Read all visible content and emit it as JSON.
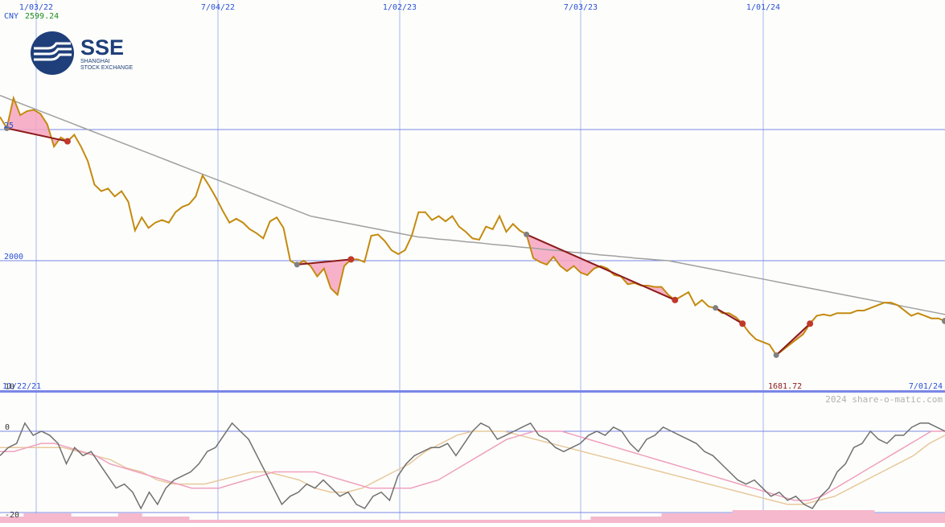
{
  "header": {
    "currency": "CNY",
    "last_value": "2599.24"
  },
  "logo": {
    "name": "SSE",
    "line1": "SHANGHAI",
    "line2": "STOCK EXCHANGE"
  },
  "colors": {
    "price": "#c48a0f",
    "moving_average": "#a0a0a0",
    "grid": "#a8b4f2",
    "grid_strong": "#7a86e6",
    "up_fill": "#7ee67e",
    "down_fill": "#f6a4c0",
    "up_trend": "#2a9a2a",
    "down_trend": "#8b1a1a",
    "osc_main": "#707070",
    "osc_fast": "#f0a0c0",
    "osc_slow": "#e8c89c",
    "volume": "#f6b8cc",
    "header_currency": "#2a4fd8",
    "header_value": "#1f8a1f"
  },
  "chart_data": [
    {
      "type": "line",
      "title": "",
      "x_labels_top": [
        "1/03/22",
        "7/04/22",
        "1/02/23",
        "7/03/23",
        "1/01/24"
      ],
      "x_range_labels": {
        "start": "11/22/21",
        "end": "7/01/24"
      },
      "y_tick_labels": [
        "25",
        "2000"
      ],
      "y_ticks": [
        2500,
        2000
      ],
      "ylim": [
        1530,
        2620
      ],
      "min_label": "1681.72",
      "watermark": "2024 share-o-matic.com",
      "grid": true,
      "series": [
        {
          "role": "price",
          "values": [
            2548,
            2505,
            2620,
            2555,
            2570,
            2575,
            2560,
            2520,
            2435,
            2470,
            2455,
            2480,
            2435,
            2380,
            2290,
            2265,
            2275,
            2245,
            2265,
            2225,
            2115,
            2165,
            2125,
            2145,
            2155,
            2145,
            2185,
            2205,
            2215,
            2245,
            2325,
            2285,
            2240,
            2190,
            2145,
            2160,
            2145,
            2120,
            2105,
            2085,
            2150,
            2165,
            2125,
            2000,
            1985,
            2000,
            1980,
            1940,
            1970,
            1895,
            1870,
            1980,
            2005,
            2005,
            1995,
            2095,
            2100,
            2075,
            2040,
            2025,
            2040,
            2095,
            2185,
            2185,
            2155,
            2170,
            2150,
            2170,
            2130,
            2110,
            2085,
            2080,
            2130,
            2120,
            2170,
            2110,
            2140,
            2115,
            2100,
            2010,
            1995,
            1985,
            2015,
            1980,
            1960,
            1980,
            1955,
            1945,
            1970,
            1980,
            1970,
            1945,
            1940,
            1910,
            1915,
            1905,
            1905,
            1900,
            1900,
            1870,
            1850,
            1865,
            1880,
            1830,
            1850,
            1825,
            1820,
            1800,
            1800,
            1785,
            1760,
            1725,
            1700,
            1690,
            1680,
            1640,
            1660,
            1680,
            1700,
            1720,
            1760,
            1790,
            1795,
            1790,
            1800,
            1800,
            1800,
            1810,
            1810,
            1820,
            1830,
            1840,
            1840,
            1830,
            1810,
            1790,
            1800,
            1790,
            1780,
            1780,
            1770
          ]
        },
        {
          "role": "moving_average",
          "values": [
            2630,
            2620,
            2610,
            2600,
            2590,
            2580,
            2570,
            2560,
            2550,
            2540,
            2530,
            2520,
            2510,
            2500,
            2490,
            2480,
            2470,
            2460,
            2450,
            2440,
            2430,
            2420,
            2410,
            2400,
            2390,
            2380,
            2370,
            2360,
            2350,
            2340,
            2330,
            2320,
            2310,
            2300,
            2290,
            2280,
            2270,
            2260,
            2250,
            2240,
            2230,
            2220,
            2210,
            2200,
            2190,
            2180,
            2170,
            2165,
            2160,
            2155,
            2150,
            2145,
            2140,
            2135,
            2130,
            2125,
            2120,
            2115,
            2110,
            2105,
            2100,
            2095,
            2090,
            2088,
            2085,
            2082,
            2080,
            2078,
            2075,
            2072,
            2070,
            2068,
            2065,
            2062,
            2060,
            2058,
            2055,
            2052,
            2050,
            2048,
            2045,
            2042,
            2040,
            2038,
            2035,
            2032,
            2030,
            2028,
            2025,
            2022,
            2020,
            2018,
            2015,
            2013,
            2010,
            2008,
            2006,
            2004,
            2002,
            2000,
            1995,
            1990,
            1985,
            1980,
            1975,
            1970,
            1965,
            1960,
            1955,
            1950,
            1945,
            1940,
            1935,
            1930,
            1925,
            1920,
            1915,
            1910,
            1905,
            1900,
            1895,
            1890,
            1885,
            1880,
            1875,
            1870,
            1865,
            1860,
            1855,
            1850,
            1845,
            1840,
            1835,
            1830,
            1825,
            1820,
            1815,
            1810,
            1805,
            1800,
            1795
          ]
        }
      ],
      "trend_lines": [
        {
          "direction": "down",
          "from": [
            1,
            2500
          ],
          "to": [
            10,
            2450
          ]
        },
        {
          "direction": "down",
          "from": [
            44,
            2260
          ],
          "to": [
            52,
            2140
          ]
        },
        {
          "direction": "down",
          "from": [
            78,
            2110
          ],
          "to": [
            100,
            2080
          ]
        },
        {
          "direction": "down",
          "from": [
            106,
            2100
          ],
          "to": [
            110,
            2060
          ]
        },
        {
          "direction": "down",
          "from": [
            115,
            2115
          ],
          "to": [
            120,
            2095
          ]
        },
        {
          "direction": "up",
          "from": [
            172,
            1830
          ],
          "to": [
            198,
            1860
          ]
        }
      ]
    },
    {
      "type": "line",
      "y_tick_labels": [
        "10",
        "0",
        "-20"
      ],
      "y_ticks": [
        10,
        0,
        -20
      ],
      "ylim": [
        -20,
        10
      ],
      "grid": true,
      "series": [
        {
          "role": "oscillator",
          "values": [
            -6,
            -4,
            -3,
            2,
            -1,
            0,
            -1,
            -3,
            -8,
            -4,
            -6,
            -5,
            -8,
            -11,
            -14,
            -13,
            -15,
            -19,
            -15,
            -18,
            -14,
            -12,
            -11,
            -10,
            -8,
            -5,
            -4,
            -1,
            2,
            0,
            -2,
            -6,
            -10,
            -14,
            -18,
            -16,
            -15,
            -13,
            -14,
            -12,
            -14,
            -16,
            -15,
            -18,
            -19,
            -16,
            -15,
            -17,
            -11,
            -8,
            -6,
            -5,
            -4,
            -4,
            -3,
            -6,
            -3,
            0,
            2,
            1,
            -2,
            -1,
            0,
            1,
            2,
            -1,
            -2,
            -4,
            -5,
            -4,
            -3,
            -1,
            0,
            -1,
            1,
            0,
            -3,
            -5,
            -2,
            -1,
            1,
            0,
            -1,
            -2,
            -3,
            -5,
            -6,
            -8,
            -10,
            -12,
            -13,
            -12,
            -14,
            -16,
            -15,
            -17,
            -16,
            -18,
            -19,
            -16,
            -14,
            -10,
            -8,
            -4,
            -3,
            0,
            -2,
            -3,
            -1,
            -1,
            1,
            2,
            2,
            1,
            0
          ]
        },
        {
          "role": "signal_fast",
          "values": [
            -5,
            -5,
            -4,
            -3,
            -3,
            -4,
            -5,
            -6,
            -8,
            -9,
            -10,
            -11,
            -12,
            -13,
            -14,
            -14,
            -14,
            -13,
            -12,
            -11,
            -10,
            -10,
            -10,
            -10,
            -11,
            -12,
            -13,
            -14,
            -14,
            -14,
            -14,
            -13,
            -12,
            -10,
            -8,
            -6,
            -4,
            -2,
            -1,
            0,
            0,
            0,
            -1,
            -2,
            -3,
            -4,
            -5,
            -6,
            -7,
            -8,
            -9,
            -10,
            -11,
            -12,
            -13,
            -14,
            -15,
            -16,
            -17,
            -17,
            -16,
            -14,
            -12,
            -10,
            -8,
            -6,
            -4,
            -2,
            0,
            0
          ]
        },
        {
          "role": "signal_slow",
          "values": [
            -4,
            -4,
            -4,
            -4,
            -4,
            -5,
            -6,
            -7,
            -9,
            -10,
            -12,
            -13,
            -13,
            -13,
            -12,
            -11,
            -10,
            -10,
            -11,
            -12,
            -14,
            -15,
            -15,
            -14,
            -12,
            -10,
            -8,
            -5,
            -3,
            -1,
            0,
            0,
            0,
            -1,
            -2,
            -3,
            -4,
            -5,
            -6,
            -7,
            -8,
            -9,
            -10,
            -11,
            -12,
            -13,
            -14,
            -15,
            -16,
            -17,
            -18,
            -18,
            -17,
            -16,
            -14,
            -12,
            -10,
            -8,
            -6,
            -3,
            -1
          ]
        },
        {
          "role": "volume",
          "values": [
            2,
            3,
            3,
            2,
            2,
            3,
            2,
            2,
            1,
            1,
            1,
            1,
            1,
            1,
            1,
            1,
            1,
            1,
            1,
            1,
            1,
            1,
            1,
            1,
            1,
            2,
            2,
            2,
            3,
            3,
            3,
            4,
            4,
            4,
            4,
            4,
            4,
            3,
            3,
            3
          ]
        }
      ]
    }
  ]
}
